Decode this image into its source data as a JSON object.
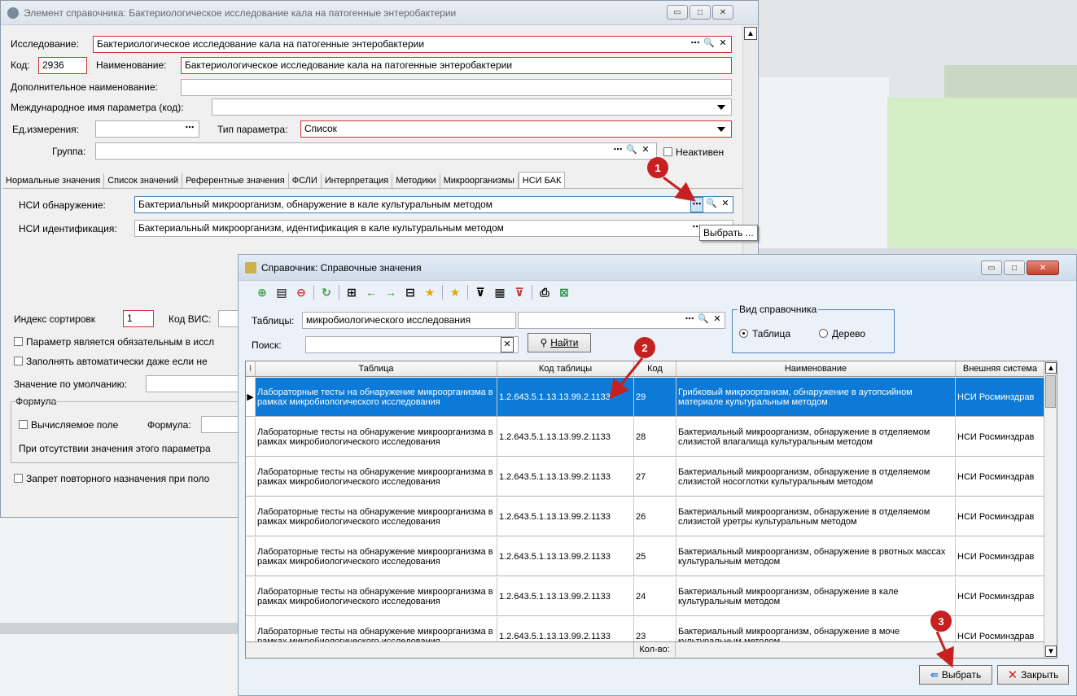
{
  "element_window": {
    "title": "Элемент справочника: Бактериологическое исследование кала на патогенные энтеробактерии",
    "research_label": "Исследование:",
    "research_value": "Бактериологическое исследование кала на патогенные энтеробактерии",
    "code_label": "Код:",
    "code_value": "2936",
    "name_label": "Наименование:",
    "name_value": "Бактериологическое исследование кала на патогенные энтеробактерии",
    "extra_name_label": "Дополнительное наименование:",
    "intl_name_label": "Международное имя параметра (код):",
    "unit_label": "Ед.измерения:",
    "param_type_label": "Тип параметра:",
    "param_type_value": "Список",
    "group_label": "Группа:",
    "inactive_label": "Неактивен",
    "tabs": [
      "Нормальные значения",
      "Список значений",
      "Референтные значения",
      "ФСЛИ",
      "Интерпретация",
      "Методики",
      "Микроорганизмы",
      "НСИ БАК"
    ],
    "nsi_detect_label": "НСИ обнаружение:",
    "nsi_detect_value": "Бактериальный микроорганизм, обнаружение в кале культуральным методом",
    "nsi_ident_label": "НСИ идентификация:",
    "nsi_ident_value": "Бактериальный микроорганизм, идентификация в кале культуральным методом",
    "tooltip": "Выбрать ...",
    "sort_index_label": "Индекс сортировк",
    "sort_index_value": "1",
    "vis_code_label": "Код ВИС:",
    "required_label": "Параметр является обязательным в иссл",
    "autofill_label": "Заполнять автоматически даже если не",
    "default_label": "Значение по умолчанию:",
    "formula_group": "Формула",
    "calc_field_label": "Вычисляемое поле",
    "formula_label": "Формула:",
    "missing_value_text": "При отсутствии значения этого параметра",
    "repeat_ban_label": "Запрет повторного назначения при поло"
  },
  "directory_window": {
    "title": "Справочник: Справочные значения",
    "tables_label": "Таблицы:",
    "tables_value": "микробиологического исследования",
    "search_label": "Поиск:",
    "find_button": "Найти",
    "view_group": "Вид справочника",
    "view_table": "Таблица",
    "view_tree": "Дерево",
    "columns": [
      "Таблица",
      "Код таблицы",
      "Код",
      "Наименование",
      "Внешняя система"
    ],
    "rows": [
      {
        "table": "Лабораторные тесты на обнаружение микроорганизма в рамках микробиологического исследования",
        "table_code": "1.2.643.5.1.13.13.99.2.1133",
        "code": "29",
        "name": "Грибковый микроорганизм, обнаружение в аутопсийном материале культуральным методом",
        "system": "НСИ Росминздрав"
      },
      {
        "table": "Лабораторные тесты на обнаружение микроорганизма в рамках микробиологического исследования",
        "table_code": "1.2.643.5.1.13.13.99.2.1133",
        "code": "28",
        "name": "Бактериальный микроорганизм, обнаружение в отделяемом слизистой влагалища культуральным методом",
        "system": "НСИ Росминздрав"
      },
      {
        "table": "Лабораторные тесты на обнаружение микроорганизма в рамках микробиологического исследования",
        "table_code": "1.2.643.5.1.13.13.99.2.1133",
        "code": "27",
        "name": "Бактериальный микроорганизм, обнаружение в отделяемом слизистой носоглотки культуральным методом",
        "system": "НСИ Росминздрав"
      },
      {
        "table": "Лабораторные тесты на обнаружение микроорганизма в рамках микробиологического исследования",
        "table_code": "1.2.643.5.1.13.13.99.2.1133",
        "code": "26",
        "name": "Бактериальный микроорганизм, обнаружение в отделяемом слизистой уретры культуральным методом",
        "system": "НСИ Росминздрав"
      },
      {
        "table": "Лабораторные тесты на обнаружение микроорганизма в рамках микробиологического исследования",
        "table_code": "1.2.643.5.1.13.13.99.2.1133",
        "code": "25",
        "name": "Бактериальный микроорганизм, обнаружение в рвотных массах культуральным методом",
        "system": "НСИ Росминздрав"
      },
      {
        "table": "Лабораторные тесты на обнаружение микроорганизма в рамках микробиологического исследования",
        "table_code": "1.2.643.5.1.13.13.99.2.1133",
        "code": "24",
        "name": "Бактериальный микроорганизм, обнаружение в кале культуральным методом",
        "system": "НСИ Росминздрав"
      },
      {
        "table": "Лабораторные тесты на обнаружение микроорганизма в рамках микробиологического исследования",
        "table_code": "1.2.643.5.1.13.13.99.2.1133",
        "code": "23",
        "name": "Бактериальный микроорганизм, обнаружение в моче культуральным методом",
        "system": "НСИ Росминздрав"
      }
    ],
    "count_label": "Кол-во:",
    "select_button": "Выбрать",
    "close_button": "Закрыть"
  },
  "markers": [
    "1",
    "2",
    "3"
  ],
  "colors": {
    "required_border": "#d93030",
    "selection": "#0c7ad6",
    "marker": "#c62020"
  }
}
